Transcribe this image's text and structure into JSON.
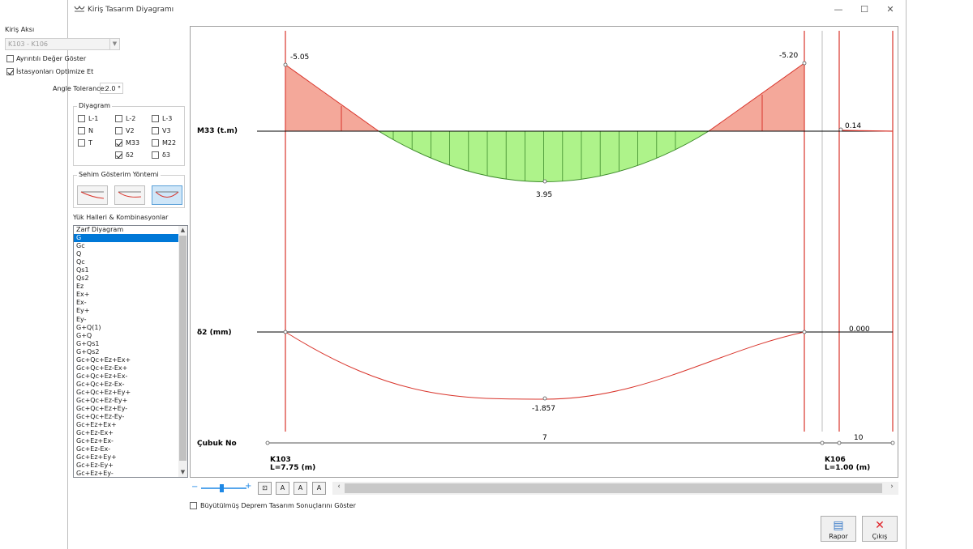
{
  "window": {
    "title": "Kiriş Tasarım Diyagramı",
    "controls": {
      "minimize": "—",
      "maximize": "☐",
      "close": "✕"
    }
  },
  "left_panel": {
    "beam_axis_label": "Kiriş Aksı",
    "beam_axis_value": "K103 - K106",
    "show_detailed_values": {
      "label": "Ayrıntılı Değer Göster",
      "checked": false
    },
    "optimize_stations": {
      "label": "İstasyonları Optimize Et",
      "checked": true
    },
    "angle_tolerance": {
      "label": "Angle Tolerance:",
      "value": "2.0 °"
    },
    "diagram_group": {
      "title": "Diyagram",
      "items": [
        {
          "label": "L-1",
          "checked": false
        },
        {
          "label": "L-2",
          "checked": false
        },
        {
          "label": "L-3",
          "checked": false
        },
        {
          "label": "N",
          "checked": false
        },
        {
          "label": "V2",
          "checked": false
        },
        {
          "label": "V3",
          "checked": false
        },
        {
          "label": "T",
          "checked": false
        },
        {
          "label": "M33",
          "checked": true
        },
        {
          "label": "M22",
          "checked": false
        },
        {
          "label": "δ2",
          "checked": true
        },
        {
          "label": "δ3",
          "checked": false
        }
      ]
    },
    "deflection_group": {
      "title": "Sehim Gösterim Yöntemi",
      "selected": 2
    },
    "load_cases_label": "Yük Halleri & Kombinasyonlar",
    "load_cases": [
      "Zarf Diyagram",
      "G",
      "Gc",
      "Q",
      "Qc",
      "Qs1",
      "Qs2",
      "Ez",
      "Ex+",
      "Ex-",
      "Ey+",
      "Ey-",
      "G+Q(1)",
      "G+Q",
      "G+Qs1",
      "G+Qs2",
      "Gc+Qc+Ez+Ex+",
      "Gc+Qc+Ez-Ex+",
      "Gc+Qc+Ez+Ex-",
      "Gc+Qc+Ez-Ex-",
      "Gc+Qc+Ez+Ey+",
      "Gc+Qc+Ez-Ey+",
      "Gc+Qc+Ez+Ey-",
      "Gc+Qc+Ez-Ey-",
      "Gc+Ez+Ex+",
      "Gc+Ez-Ex+",
      "Gc+Ez+Ex-",
      "Gc+Ez-Ex-",
      "Gc+Ez+Ey+",
      "Gc+Ez-Ey+",
      "Gc+Ez+Ey-"
    ],
    "selected_case": "G"
  },
  "diagram": {
    "m33": {
      "label": "M33 (t.m)",
      "left_value": "-5.05",
      "right_value": "-5.20",
      "mid_value": "3.95",
      "tail_value": "0.14"
    },
    "d2": {
      "label": "δ2 (mm)",
      "mid_value": "-1.857",
      "tail_value": "0.000"
    },
    "members": {
      "label": "Çubuk No",
      "span1_no": "7",
      "span2_no": "10",
      "span1_name": "K103",
      "span1_length": "L=7.75 (m)",
      "span2_name": "K106",
      "span2_length": "L=1.00 (m)"
    },
    "colors": {
      "negative_fill": "#f4a89a",
      "positive_fill": "#aef38a",
      "outline": "#d9352c",
      "baseline": "#000000"
    }
  },
  "toolbar": {
    "zoom_minus": "−",
    "zoom_plus": "+",
    "fit_button": "⊡",
    "font_smaller": "A",
    "font_larger": "A",
    "font_reset": "A"
  },
  "footer": {
    "amplified_seismic": {
      "label": "Büyütülmüş Deprem Tasarım Sonuçlarını Göster",
      "checked": false
    },
    "report_button": "Rapor",
    "exit_button": "Çıkış"
  }
}
